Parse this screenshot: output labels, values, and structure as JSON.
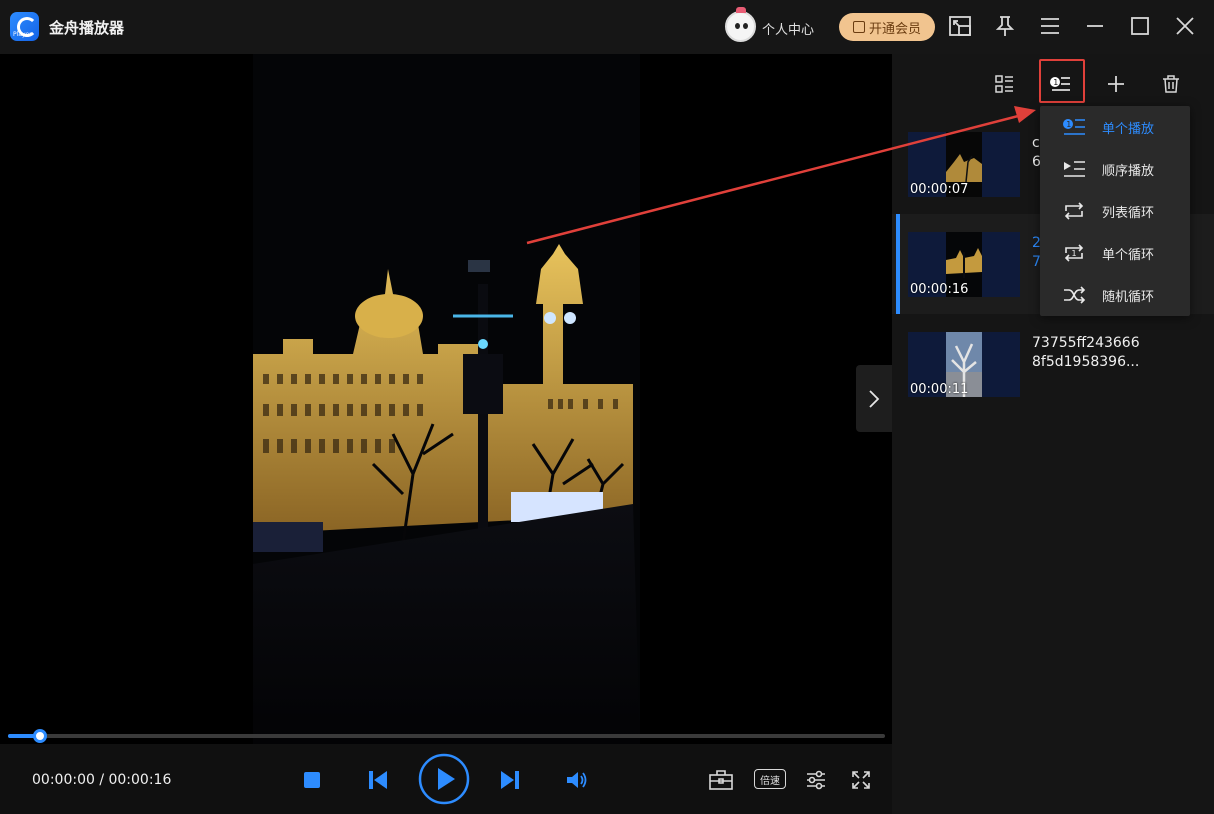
{
  "app": {
    "title": "金舟播放器",
    "user_center": "个人中心",
    "vip_label": "开通会员"
  },
  "colors": {
    "accent": "#2d8cff",
    "vip": "#f1c48f",
    "highlight": "#e0403a"
  },
  "window_controls": [
    {
      "name": "mini-mode-icon"
    },
    {
      "name": "pin-icon"
    },
    {
      "name": "menu-icon"
    },
    {
      "name": "minimize-icon"
    },
    {
      "name": "maximize-icon"
    },
    {
      "name": "close-icon"
    }
  ],
  "player": {
    "current_time": "00:00:00",
    "total_time": "00:00:16",
    "time_display": "00:00:00 / 00:00:16",
    "progress": 0.037,
    "speed_label": "倍速"
  },
  "playlist": {
    "toolbar": [
      {
        "name": "list-view-icon"
      },
      {
        "name": "play-mode-icon"
      },
      {
        "name": "add-icon"
      },
      {
        "name": "delete-icon"
      }
    ],
    "items": [
      {
        "name": "c\n6",
        "duration": "00:00:07",
        "active": false
      },
      {
        "name": "2\n7",
        "duration": "00:00:16",
        "active": true
      },
      {
        "name": "73755ff243666\n8f5d1958396...",
        "duration": "00:00:11",
        "active": false
      }
    ]
  },
  "play_mode_menu": {
    "selected": "单个播放",
    "items": [
      {
        "label": "单个播放",
        "icon": "single-play-icon"
      },
      {
        "label": "顺序播放",
        "icon": "sequential-play-icon"
      },
      {
        "label": "列表循环",
        "icon": "list-loop-icon"
      },
      {
        "label": "单个循环",
        "icon": "single-loop-icon"
      },
      {
        "label": "随机循环",
        "icon": "shuffle-icon"
      }
    ]
  }
}
